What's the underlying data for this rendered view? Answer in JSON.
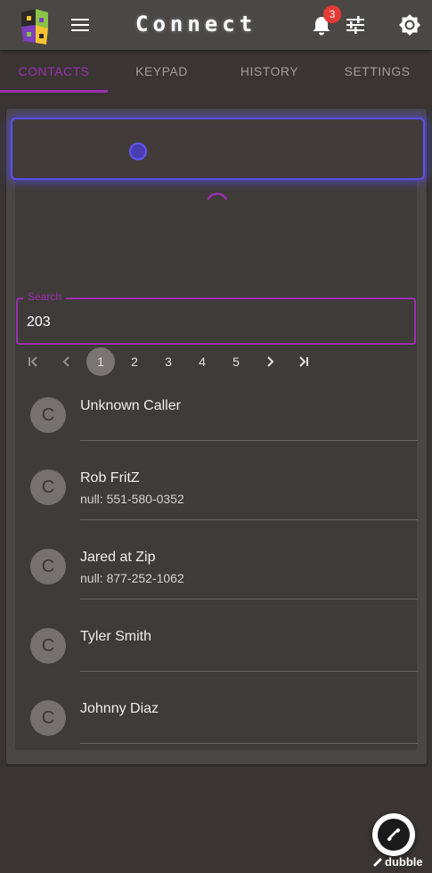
{
  "app": {
    "title": "Connect",
    "notification_count": "3",
    "accent_color": "#9c2fb0",
    "icons": {
      "menu": "hamburger-menu-icon",
      "notifications": "bell-icon",
      "filters": "tune-sliders-icon",
      "theme": "brightness-icon"
    }
  },
  "tabs": [
    {
      "label": "CONTACTS",
      "active": true
    },
    {
      "label": "KEYPAD",
      "active": false
    },
    {
      "label": "HISTORY",
      "active": false
    },
    {
      "label": "SETTINGS",
      "active": false
    }
  ],
  "search": {
    "label": "Search",
    "value": "203"
  },
  "pagination": {
    "pages": [
      "1",
      "2",
      "3",
      "4",
      "5"
    ],
    "current": "1"
  },
  "contacts": [
    {
      "initial": "C",
      "name": "Unknown Caller",
      "phone": ""
    },
    {
      "initial": "C",
      "name": "Rob FritZ",
      "phone": "null: 551-580-0352"
    },
    {
      "initial": "C",
      "name": "Jared at Zip",
      "phone": "null: 877-252-1062"
    },
    {
      "initial": "C",
      "name": "Tyler Smith",
      "phone": ""
    },
    {
      "initial": "C",
      "name": "Johnny Diaz",
      "phone": ""
    }
  ],
  "branding": {
    "label": "dubble"
  }
}
